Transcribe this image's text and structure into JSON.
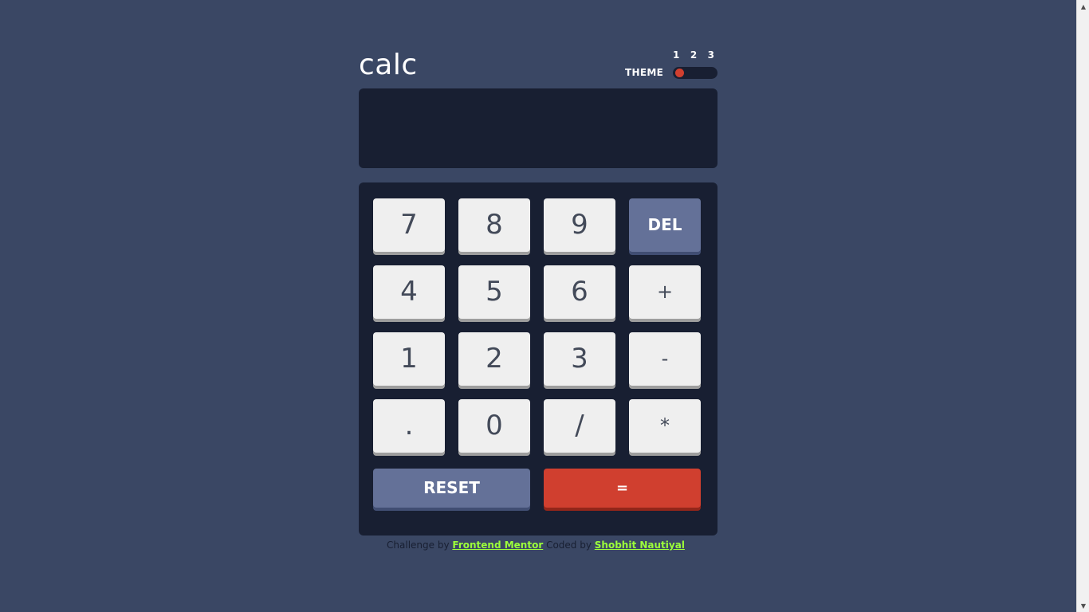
{
  "app": {
    "title": "calc"
  },
  "theme": {
    "label": "THEME",
    "options": [
      "1",
      "2",
      "3"
    ],
    "selected": "1"
  },
  "display": {
    "value": ""
  },
  "keys": {
    "row1": [
      "7",
      "8",
      "9",
      "DEL"
    ],
    "row2": [
      "4",
      "5",
      "6",
      "+"
    ],
    "row3": [
      "1",
      "2",
      "3",
      "-"
    ],
    "row4": [
      ".",
      "0",
      "/",
      "*"
    ],
    "reset": "RESET",
    "equals": "="
  },
  "footer": {
    "prefix": "Challenge by",
    "link1": "Frontend Mentor",
    "middle": "Coded by",
    "link2": "Shobhit Nautiyal"
  },
  "colors": {
    "background": "#3a4764",
    "panel": "#181f32",
    "key": "#efefef",
    "key_text": "#434a59",
    "accent_blue": "#647198",
    "accent_red": "#d03f2f",
    "link": "#9cff3a"
  }
}
